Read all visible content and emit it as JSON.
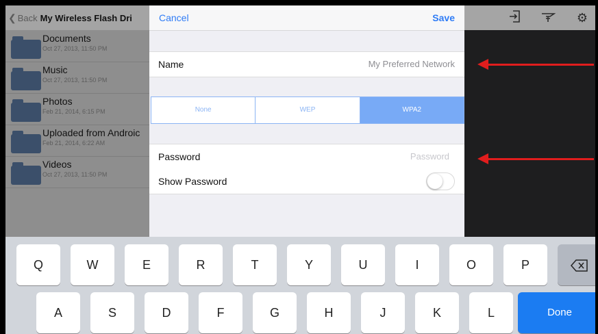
{
  "nav": {
    "back_label": "Back",
    "title": "My Wireless Flash Dri"
  },
  "folders": [
    {
      "name": "Documents",
      "date": "Oct 27, 2013, 11:50 PM"
    },
    {
      "name": "Music",
      "date": "Oct 27, 2013, 11:50 PM"
    },
    {
      "name": "Photos",
      "date": "Feb 21, 2014, 6:15 PM"
    },
    {
      "name": "Uploaded from Androic",
      "date": "Feb 21, 2014, 6:22 AM"
    },
    {
      "name": "Videos",
      "date": "Oct 27, 2013, 11:50 PM"
    }
  ],
  "toolbar_icons": [
    "import-icon",
    "antenna-icon",
    "gear-icon"
  ],
  "form": {
    "cancel_label": "Cancel",
    "save_label": "Save",
    "name_label": "Name",
    "name_value": "My Preferred Network",
    "security_options": [
      "None",
      "WEP",
      "WPA2"
    ],
    "security_selected": "WPA2",
    "password_label": "Password",
    "password_placeholder": "Password",
    "show_password_label": "Show Password",
    "show_password_on": false
  },
  "keyboard": {
    "row1": [
      "Q",
      "W",
      "E",
      "R",
      "T",
      "Y",
      "U",
      "I",
      "O",
      "P"
    ],
    "backspace_icon": "backspace-icon",
    "row2": [
      "A",
      "S",
      "D",
      "F",
      "G",
      "H",
      "J",
      "K",
      "L"
    ],
    "done_label": "Done"
  },
  "colors": {
    "accent": "#2f7cf6",
    "annotation_arrow": "#e01d1d",
    "done_key": "#1b7cf2"
  }
}
